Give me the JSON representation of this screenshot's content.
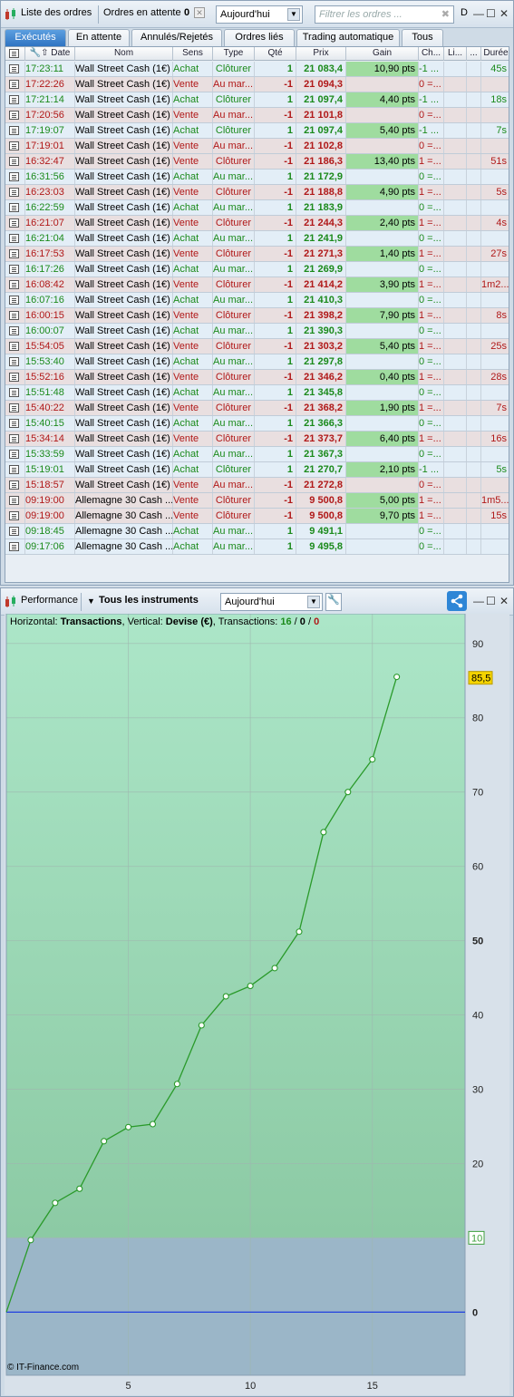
{
  "orders_window": {
    "title": "Liste des ordres",
    "pending_label": "Ordres en attente",
    "pending_count": "0",
    "period": "Aujourd'hui",
    "filter_placeholder": "Filtrer les ordres ...",
    "d_label": "D",
    "tabs": [
      "Exécutés",
      "En attente",
      "Annulés/Rejetés",
      "Ordres liés",
      "Trading automatique",
      "Tous"
    ],
    "columns": [
      "Date",
      "Nom",
      "Sens",
      "Type",
      "Qté",
      "Prix",
      "Gain",
      "Ch...",
      "Li...",
      "...",
      "Durée"
    ],
    "rows": [
      {
        "time": "17:23:11",
        "name": "Wall Street Cash (1€)",
        "side": "Achat",
        "type": "Clôturer",
        "qty": "1",
        "price": "21 083,4",
        "gain": "10,90 pts",
        "ch": "-1 ...",
        "dur": "45s"
      },
      {
        "time": "17:22:26",
        "name": "Wall Street Cash (1€)",
        "side": "Vente",
        "type": "Au mar...",
        "qty": "-1",
        "price": "21 094,3",
        "gain": "",
        "ch": "0 =...",
        "dur": ""
      },
      {
        "time": "17:21:14",
        "name": "Wall Street Cash (1€)",
        "side": "Achat",
        "type": "Clôturer",
        "qty": "1",
        "price": "21 097,4",
        "gain": "4,40 pts",
        "ch": "-1 ...",
        "dur": "18s"
      },
      {
        "time": "17:20:56",
        "name": "Wall Street Cash (1€)",
        "side": "Vente",
        "type": "Au mar...",
        "qty": "-1",
        "price": "21 101,8",
        "gain": "",
        "ch": "0 =...",
        "dur": ""
      },
      {
        "time": "17:19:07",
        "name": "Wall Street Cash (1€)",
        "side": "Achat",
        "type": "Clôturer",
        "qty": "1",
        "price": "21 097,4",
        "gain": "5,40 pts",
        "ch": "-1 ...",
        "dur": "7s"
      },
      {
        "time": "17:19:01",
        "name": "Wall Street Cash (1€)",
        "side": "Vente",
        "type": "Au mar...",
        "qty": "-1",
        "price": "21 102,8",
        "gain": "",
        "ch": "0 =...",
        "dur": ""
      },
      {
        "time": "16:32:47",
        "name": "Wall Street Cash (1€)",
        "side": "Vente",
        "type": "Clôturer",
        "qty": "-1",
        "price": "21 186,3",
        "gain": "13,40 pts",
        "ch": "1 =...",
        "dur": "51s"
      },
      {
        "time": "16:31:56",
        "name": "Wall Street Cash (1€)",
        "side": "Achat",
        "type": "Au mar...",
        "qty": "1",
        "price": "21 172,9",
        "gain": "",
        "ch": "0 =...",
        "dur": ""
      },
      {
        "time": "16:23:03",
        "name": "Wall Street Cash (1€)",
        "side": "Vente",
        "type": "Clôturer",
        "qty": "-1",
        "price": "21 188,8",
        "gain": "4,90 pts",
        "ch": "1 =...",
        "dur": "5s"
      },
      {
        "time": "16:22:59",
        "name": "Wall Street Cash (1€)",
        "side": "Achat",
        "type": "Au mar...",
        "qty": "1",
        "price": "21 183,9",
        "gain": "",
        "ch": "0 =...",
        "dur": ""
      },
      {
        "time": "16:21:07",
        "name": "Wall Street Cash (1€)",
        "side": "Vente",
        "type": "Clôturer",
        "qty": "-1",
        "price": "21 244,3",
        "gain": "2,40 pts",
        "ch": "1 =...",
        "dur": "4s"
      },
      {
        "time": "16:21:04",
        "name": "Wall Street Cash (1€)",
        "side": "Achat",
        "type": "Au mar...",
        "qty": "1",
        "price": "21 241,9",
        "gain": "",
        "ch": "0 =...",
        "dur": ""
      },
      {
        "time": "16:17:53",
        "name": "Wall Street Cash (1€)",
        "side": "Vente",
        "type": "Clôturer",
        "qty": "-1",
        "price": "21 271,3",
        "gain": "1,40 pts",
        "ch": "1 =...",
        "dur": "27s"
      },
      {
        "time": "16:17:26",
        "name": "Wall Street Cash (1€)",
        "side": "Achat",
        "type": "Au mar...",
        "qty": "1",
        "price": "21 269,9",
        "gain": "",
        "ch": "0 =...",
        "dur": ""
      },
      {
        "time": "16:08:42",
        "name": "Wall Street Cash (1€)",
        "side": "Vente",
        "type": "Clôturer",
        "qty": "-1",
        "price": "21 414,2",
        "gain": "3,90 pts",
        "ch": "1 =...",
        "dur": "1m2..."
      },
      {
        "time": "16:07:16",
        "name": "Wall Street Cash (1€)",
        "side": "Achat",
        "type": "Au mar...",
        "qty": "1",
        "price": "21 410,3",
        "gain": "",
        "ch": "0 =...",
        "dur": ""
      },
      {
        "time": "16:00:15",
        "name": "Wall Street Cash (1€)",
        "side": "Vente",
        "type": "Clôturer",
        "qty": "-1",
        "price": "21 398,2",
        "gain": "7,90 pts",
        "ch": "1 =...",
        "dur": "8s"
      },
      {
        "time": "16:00:07",
        "name": "Wall Street Cash (1€)",
        "side": "Achat",
        "type": "Au mar...",
        "qty": "1",
        "price": "21 390,3",
        "gain": "",
        "ch": "0 =...",
        "dur": ""
      },
      {
        "time": "15:54:05",
        "name": "Wall Street Cash (1€)",
        "side": "Vente",
        "type": "Clôturer",
        "qty": "-1",
        "price": "21 303,2",
        "gain": "5,40 pts",
        "ch": "1 =...",
        "dur": "25s"
      },
      {
        "time": "15:53:40",
        "name": "Wall Street Cash (1€)",
        "side": "Achat",
        "type": "Au mar...",
        "qty": "1",
        "price": "21 297,8",
        "gain": "",
        "ch": "0 =...",
        "dur": ""
      },
      {
        "time": "15:52:16",
        "name": "Wall Street Cash (1€)",
        "side": "Vente",
        "type": "Clôturer",
        "qty": "-1",
        "price": "21 346,2",
        "gain": "0,40 pts",
        "ch": "1 =...",
        "dur": "28s"
      },
      {
        "time": "15:51:48",
        "name": "Wall Street Cash (1€)",
        "side": "Achat",
        "type": "Au mar...",
        "qty": "1",
        "price": "21 345,8",
        "gain": "",
        "ch": "0 =...",
        "dur": ""
      },
      {
        "time": "15:40:22",
        "name": "Wall Street Cash (1€)",
        "side": "Vente",
        "type": "Clôturer",
        "qty": "-1",
        "price": "21 368,2",
        "gain": "1,90 pts",
        "ch": "1 =...",
        "dur": "7s"
      },
      {
        "time": "15:40:15",
        "name": "Wall Street Cash (1€)",
        "side": "Achat",
        "type": "Au mar...",
        "qty": "1",
        "price": "21 366,3",
        "gain": "",
        "ch": "0 =...",
        "dur": ""
      },
      {
        "time": "15:34:14",
        "name": "Wall Street Cash (1€)",
        "side": "Vente",
        "type": "Clôturer",
        "qty": "-1",
        "price": "21 373,7",
        "gain": "6,40 pts",
        "ch": "1 =...",
        "dur": "16s"
      },
      {
        "time": "15:33:59",
        "name": "Wall Street Cash (1€)",
        "side": "Achat",
        "type": "Au mar...",
        "qty": "1",
        "price": "21 367,3",
        "gain": "",
        "ch": "0 =...",
        "dur": ""
      },
      {
        "time": "15:19:01",
        "name": "Wall Street Cash (1€)",
        "side": "Achat",
        "type": "Clôturer",
        "qty": "1",
        "price": "21 270,7",
        "gain": "2,10 pts",
        "ch": "-1 ...",
        "dur": "5s"
      },
      {
        "time": "15:18:57",
        "name": "Wall Street Cash (1€)",
        "side": "Vente",
        "type": "Au mar...",
        "qty": "-1",
        "price": "21 272,8",
        "gain": "",
        "ch": "0 =...",
        "dur": ""
      },
      {
        "time": "09:19:00",
        "name": "Allemagne 30 Cash ...",
        "side": "Vente",
        "type": "Clôturer",
        "qty": "-1",
        "price": "9 500,8",
        "gain": "5,00 pts",
        "ch": "1 =...",
        "dur": "1m5..."
      },
      {
        "time": "09:19:00",
        "name": "Allemagne 30 Cash ...",
        "side": "Vente",
        "type": "Clôturer",
        "qty": "-1",
        "price": "9 500,8",
        "gain": "9,70 pts",
        "ch": "1 =...",
        "dur": "15s"
      },
      {
        "time": "09:18:45",
        "name": "Allemagne 30 Cash ...",
        "side": "Achat",
        "type": "Au mar...",
        "qty": "1",
        "price": "9 491,1",
        "gain": "",
        "ch": "0 =...",
        "dur": ""
      },
      {
        "time": "09:17:06",
        "name": "Allemagne 30 Cash ...",
        "side": "Achat",
        "type": "Au mar...",
        "qty": "1",
        "price": "9 495,8",
        "gain": "",
        "ch": "0 =...",
        "dur": ""
      }
    ]
  },
  "perf_window": {
    "title": "Performance",
    "instruments": "Tous les instruments",
    "period": "Aujourd'hui",
    "info_prefix_h": "Horizontal: ",
    "info_h": "Transactions",
    "info_prefix_v": ", Vertical: ",
    "info_v": "Devise (€)",
    "info_prefix_t": ", Transactions: ",
    "info_t1": "16",
    "info_sep1": " / ",
    "info_t2": "0",
    "info_sep2": " / ",
    "info_t3": "0",
    "copyright": "© IT-Finance.com",
    "last_value_label": "85,5",
    "threshold_label": "10"
  },
  "chart_data": {
    "type": "line",
    "x": [
      0,
      1,
      2,
      3,
      4,
      5,
      6,
      7,
      8,
      9,
      10,
      11,
      12,
      13,
      14,
      15,
      16
    ],
    "y": [
      0,
      9.7,
      14.7,
      16.6,
      23.0,
      24.9,
      25.3,
      30.7,
      38.6,
      42.5,
      43.9,
      46.3,
      51.2,
      64.6,
      70.0,
      74.4,
      85.5
    ],
    "xticks": [
      5,
      10,
      15
    ],
    "yticks": [
      0,
      10,
      20,
      30,
      40,
      50,
      60,
      70,
      80,
      90
    ],
    "ytick_labels": [
      "0",
      "",
      "20",
      "30",
      "40",
      "50",
      "60",
      "70",
      "80",
      "90"
    ],
    "xlim": [
      0,
      18.8
    ],
    "ylim": [
      -8.5,
      94
    ],
    "threshold": 10,
    "colors": {
      "line": "#2a9a2a",
      "above": "#8fd3a8",
      "below": "#9bb6c8",
      "zero_line": "#1f3fe0",
      "label_box": "#f5d400"
    }
  }
}
